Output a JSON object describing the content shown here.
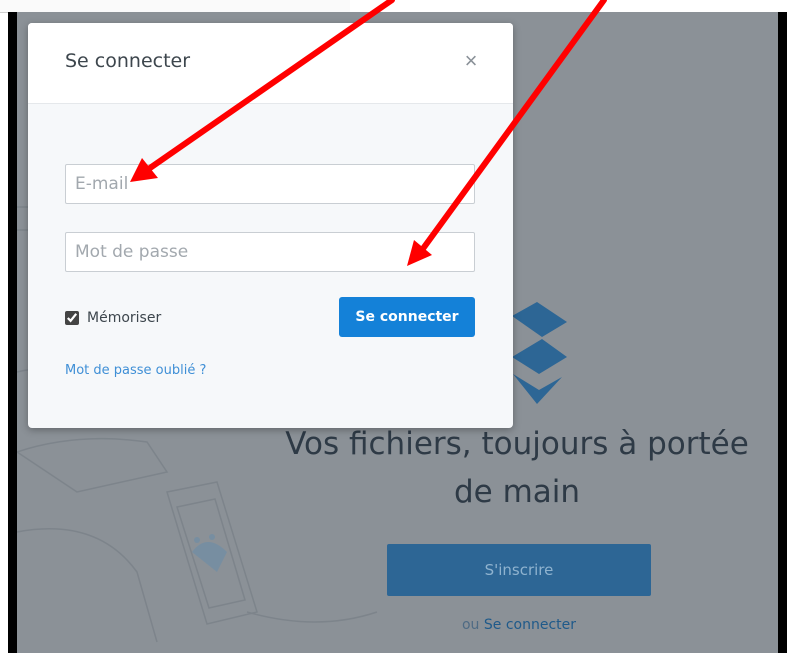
{
  "modal": {
    "title": "Se connecter",
    "close_symbol": "×",
    "email_placeholder": "E-mail",
    "password_placeholder": "Mot de passe",
    "remember_label": "Mémoriser",
    "remember_checked": true,
    "submit_label": "Se connecter",
    "forgot_link": "Mot de passe oublié ?"
  },
  "hero": {
    "title": "Vos fichiers, toujours à portée de main",
    "signup_label": "S'inscrire",
    "or_text": "ou",
    "signin_link": "Se connecter"
  },
  "icons": [
    "close-icon",
    "dropbox-logo-icon",
    "arrow-annotation-icon"
  ],
  "colors": {
    "primary_button": "#1481d8",
    "link": "#3f8fd6",
    "overlay_background": "#8b9197",
    "annotation_arrow": "#ff0000"
  }
}
